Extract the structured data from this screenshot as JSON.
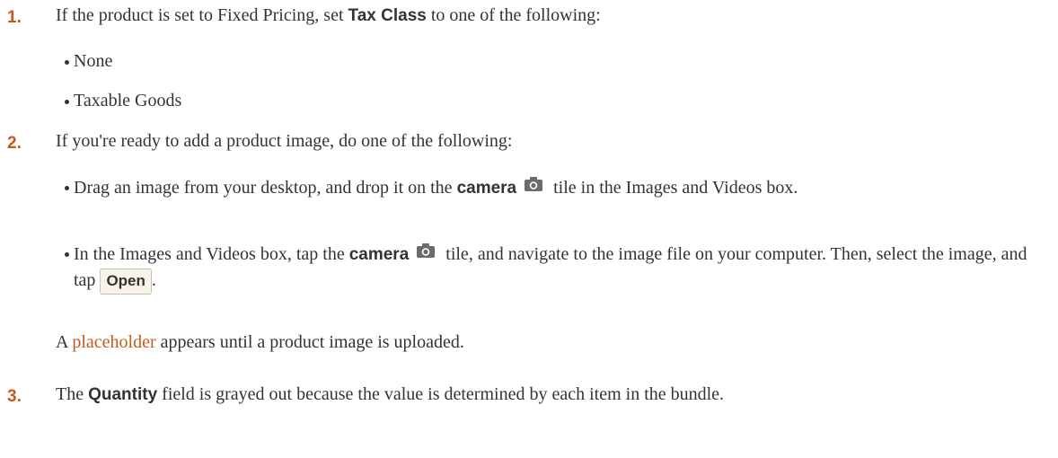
{
  "steps": [
    {
      "number": "1.",
      "before": "If the product is set to Fixed Pricing, set ",
      "ui_term": "Tax Class",
      "after": " to one of the following:",
      "options": [
        "None",
        "Taxable Goods"
      ]
    },
    {
      "number": "2.",
      "text": "If you're ready to add a product image, do one of the following:",
      "bullet1": {
        "before": "Drag an image from your desktop, and drop it on the ",
        "ui_term": "camera",
        "after": " tile in the Images and Videos box."
      },
      "bullet2": {
        "before": "In the Images and Videos box, tap the ",
        "ui_term": "camera",
        "after": " tile, and navigate to the image file on your computer. Then, select the image, and tap ",
        "button_label": "Open",
        "end": "."
      },
      "note": {
        "before": "A ",
        "link": "placeholder",
        "after": " appears until a product image is uploaded."
      }
    },
    {
      "number": "3.",
      "before": "The ",
      "ui_term": "Quantity",
      "after": " field is grayed out because the value is determined by each item in the bundle."
    }
  ],
  "icons": {
    "camera": "camera-icon"
  },
  "colors": {
    "accent": "#c45a1d",
    "text": "#333333",
    "button_bg": "#f8f4ea"
  }
}
